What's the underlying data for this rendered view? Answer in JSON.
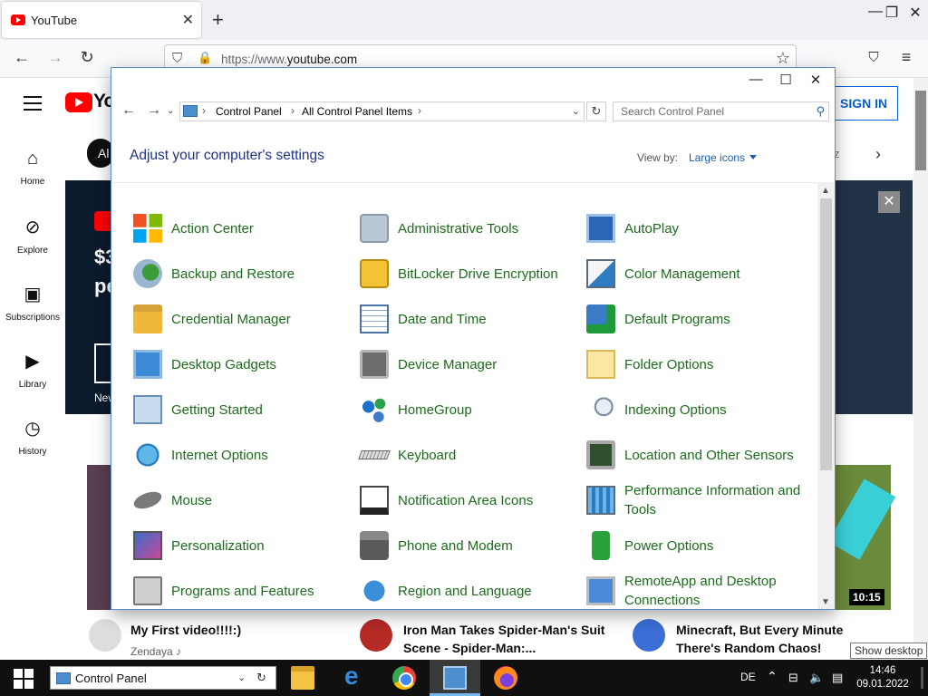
{
  "browser": {
    "tab_title": "YouTube",
    "url_prefix": "https://www.",
    "url_domain": "youtube.com"
  },
  "youtube": {
    "logo_text": "Yo",
    "signin_label": "SIGN IN",
    "chip_label": "Al",
    "chip_right_fragment": "z",
    "sidebar": [
      {
        "label": "Home",
        "icon": "home-icon"
      },
      {
        "label": "Explore",
        "icon": "compass-icon"
      },
      {
        "label": "Subscriptions",
        "icon": "subscriptions-icon"
      },
      {
        "label": "Library",
        "icon": "library-icon"
      },
      {
        "label": "History",
        "icon": "history-icon"
      }
    ],
    "banner": {
      "line1": "$3",
      "line2": "pe",
      "new_label": "New"
    },
    "duration": "10:15",
    "videos": [
      {
        "title": "My First video!!!!:)",
        "channel": "Zendaya ♪"
      },
      {
        "title_line1": "Iron Man Takes Spider-Man's Suit",
        "title_line2": "Scene - Spider-Man:..."
      },
      {
        "title_line1": "Minecraft, But Every Minute",
        "title_line2": "There's Random Chaos!"
      }
    ],
    "show_desktop_tooltip": "Show desktop"
  },
  "control_panel": {
    "breadcrumb": [
      "Control Panel",
      "All Control Panel Items"
    ],
    "search_placeholder": "Search Control Panel",
    "heading": "Adjust your computer's settings",
    "view_by_label": "View by:",
    "view_by_value": "Large icons",
    "items": [
      {
        "label": "Action Center",
        "icon": "action-center-icon"
      },
      {
        "label": "Administrative Tools",
        "icon": "administrative-tools-icon"
      },
      {
        "label": "AutoPlay",
        "icon": "autoplay-icon"
      },
      {
        "label": "Backup and Restore",
        "icon": "backup-restore-icon"
      },
      {
        "label": "BitLocker Drive Encryption",
        "icon": "bitlocker-icon"
      },
      {
        "label": "Color Management",
        "icon": "color-management-icon"
      },
      {
        "label": "Credential Manager",
        "icon": "credential-manager-icon"
      },
      {
        "label": "Date and Time",
        "icon": "date-time-icon"
      },
      {
        "label": "Default Programs",
        "icon": "default-programs-icon"
      },
      {
        "label": "Desktop Gadgets",
        "icon": "desktop-gadgets-icon"
      },
      {
        "label": "Device Manager",
        "icon": "device-manager-icon"
      },
      {
        "label": "Folder Options",
        "icon": "folder-options-icon"
      },
      {
        "label": "Getting Started",
        "icon": "getting-started-icon"
      },
      {
        "label": "HomeGroup",
        "icon": "homegroup-icon"
      },
      {
        "label": "Indexing Options",
        "icon": "indexing-options-icon"
      },
      {
        "label": "Internet Options",
        "icon": "internet-options-icon"
      },
      {
        "label": "Keyboard",
        "icon": "keyboard-icon"
      },
      {
        "label": "Location and Other Sensors",
        "icon": "location-sensors-icon"
      },
      {
        "label": "Mouse",
        "icon": "mouse-icon"
      },
      {
        "label": "Notification Area Icons",
        "icon": "notification-area-icon"
      },
      {
        "label": "Performance Information and Tools",
        "icon": "performance-icon"
      },
      {
        "label": "Personalization",
        "icon": "personalization-icon"
      },
      {
        "label": "Phone and Modem",
        "icon": "phone-modem-icon"
      },
      {
        "label": "Power Options",
        "icon": "power-options-icon"
      },
      {
        "label": "Programs and Features",
        "icon": "programs-features-icon"
      },
      {
        "label": "Region and Language",
        "icon": "region-language-icon"
      },
      {
        "label": "RemoteApp and Desktop Connections",
        "icon": "remoteapp-icon"
      }
    ]
  },
  "taskbar": {
    "search_text": "Control Panel",
    "language": "DE",
    "time": "14:46",
    "date": "09.01.2022",
    "apps": [
      "file-explorer-icon",
      "edge-icon",
      "chrome-icon",
      "control-panel-icon",
      "firefox-icon"
    ]
  },
  "colors": {
    "cp_link_green": "#1c6b1c",
    "cp_heading_blue": "#1e3287",
    "yt_red": "#ff0000",
    "yt_signin_blue": "#065fd4",
    "taskbar": "#101010"
  }
}
